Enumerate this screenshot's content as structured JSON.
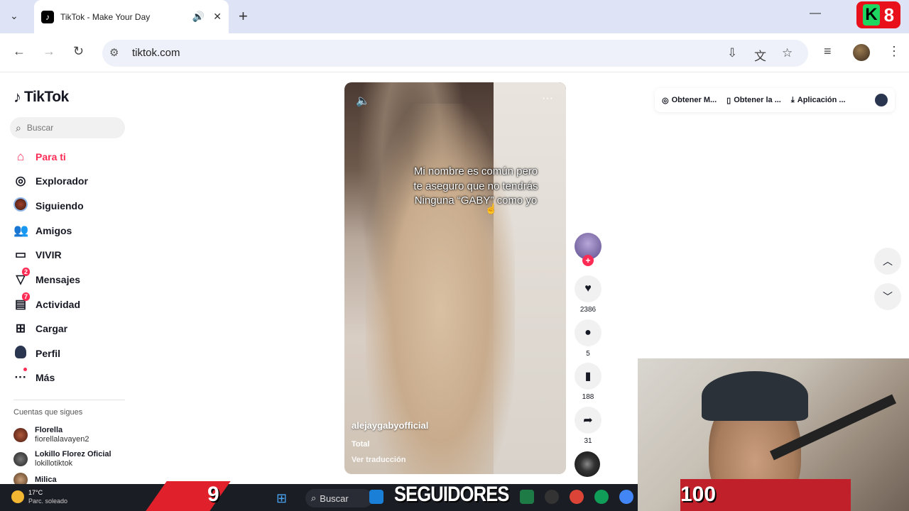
{
  "browser": {
    "tab_title": "TikTok - Make Your Day",
    "url": "tiktok.com",
    "overlay_badge": {
      "letter": "K",
      "number": "8"
    }
  },
  "sidebar": {
    "logo_text": "TikTok",
    "search_placeholder": "Buscar",
    "nav": [
      {
        "label": "Para ti",
        "icon": "home-icon"
      },
      {
        "label": "Explorador",
        "icon": "compass-icon"
      },
      {
        "label": "Siguiendo",
        "icon": "following-avatar-icon"
      },
      {
        "label": "Amigos",
        "icon": "friends-icon"
      },
      {
        "label": "VIVIR",
        "icon": "live-icon"
      },
      {
        "label": "Mensajes",
        "icon": "messages-icon",
        "badge": "2"
      },
      {
        "label": "Actividad",
        "icon": "activity-icon",
        "badge": "7"
      },
      {
        "label": "Cargar",
        "icon": "upload-icon"
      },
      {
        "label": "Perfil",
        "icon": "profile-icon"
      },
      {
        "label": "Más",
        "icon": "more-icon"
      }
    ],
    "following_title": "Cuentas que sigues",
    "accounts": [
      {
        "name": "Florella",
        "handle": "fiorellalavayen2"
      },
      {
        "name": "Lokillo Florez Oficial",
        "handle": "lokillotiktok"
      },
      {
        "name": "Milica",
        "handle": ""
      }
    ]
  },
  "video": {
    "caption_lines": [
      "Mi nombre es común pero",
      "te aseguro que no tendrás",
      "Ninguna “GABY” como yo"
    ],
    "author": "alejaygabyofficial",
    "description": "Total",
    "translate_label": "Ver traducción"
  },
  "actions": {
    "likes": "2386",
    "comments": "5",
    "saves": "188",
    "shares": "31"
  },
  "top_pills": [
    "Obtener M...",
    "Obtener la ...",
    "Aplicación ..."
  ],
  "taskbar": {
    "temperature": "17°C",
    "weather": "Parc. soleado",
    "search_label": "Buscar",
    "counter_left": "9",
    "followers_label": "SEGUIDORES",
    "counter_right": "100"
  },
  "colors": {
    "accent": "#fe2c55",
    "tabstrip": "#dfe3f6"
  }
}
